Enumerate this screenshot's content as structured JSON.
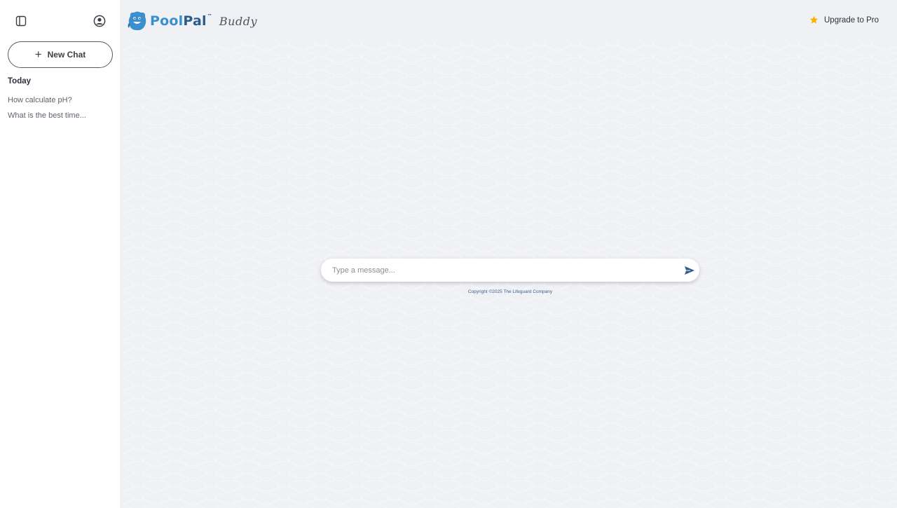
{
  "sidebar": {
    "new_chat_label": "New Chat",
    "section_title": "Today",
    "history": [
      {
        "label": "How calculate pH?"
      },
      {
        "label": "What is the best time..."
      }
    ]
  },
  "header": {
    "logo_text_part1": "Pool",
    "logo_text_part2": "Pal",
    "logo_tm": "™",
    "logo_subtitle": "Buddy",
    "upgrade_label": "Upgrade to Pro"
  },
  "composer": {
    "placeholder": "Type a message...",
    "value": ""
  },
  "footer": {
    "copyright": "Copyright ©2025 The Lifeguard Company"
  },
  "colors": {
    "accent": "#2b5c8a",
    "logo_blue": "#3a8fcf",
    "star": "#f5b400",
    "main_bg": "#f0f1f5"
  },
  "icons": {
    "sidebar_toggle": "sidebar-toggle-icon",
    "account": "account-icon",
    "plus": "plus-icon",
    "star": "star-icon",
    "send": "send-icon",
    "logo": "logo-mascot-icon"
  }
}
